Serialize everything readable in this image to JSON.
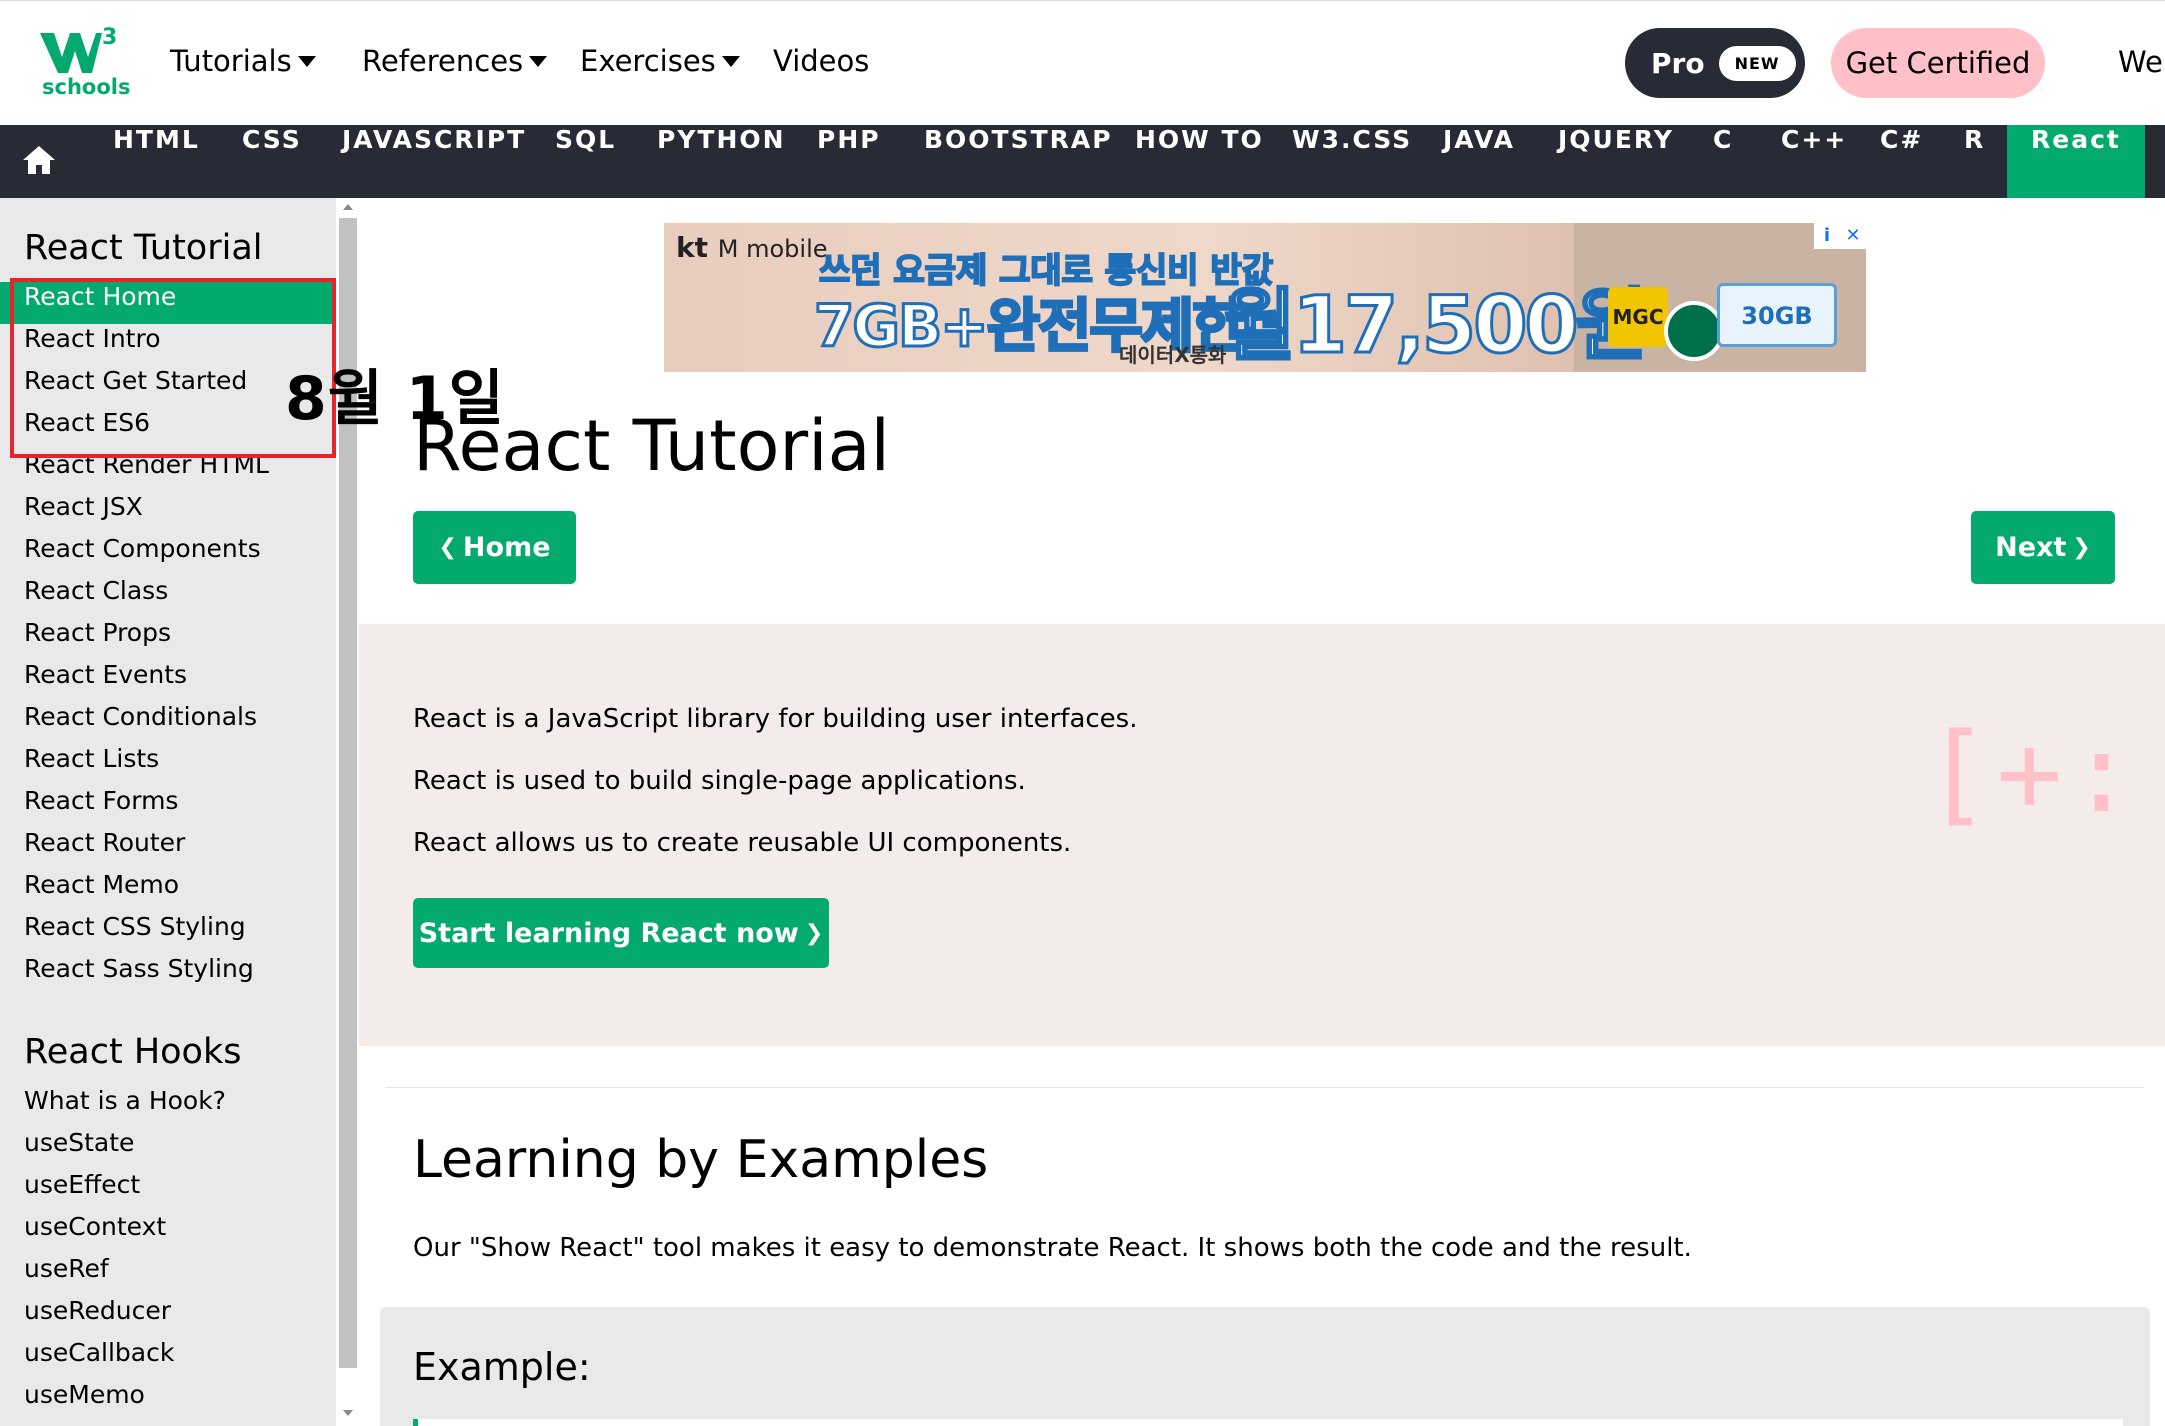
{
  "header": {
    "logo": {
      "superscript": "3",
      "wordmark": "schools"
    },
    "nav": [
      {
        "label": "Tutorials",
        "dropdown": true
      },
      {
        "label": "References",
        "dropdown": true
      },
      {
        "label": "Exercises",
        "dropdown": true
      },
      {
        "label": "Videos",
        "dropdown": false
      }
    ],
    "pro_label": "Pro",
    "pro_badge": "NEW",
    "certified_label": "Get Certified",
    "cut_label": "Web"
  },
  "subjects": {
    "home_icon": "home-icon",
    "items": [
      "HTML",
      "CSS",
      "JAVASCRIPT",
      "SQL",
      "PYTHON",
      "PHP",
      "BOOTSTRAP",
      "HOW TO",
      "W3.CSS",
      "JAVA",
      "JQUERY",
      "C",
      "C++",
      "C#",
      "R",
      "React"
    ],
    "active": "React"
  },
  "sidebar": {
    "section1_title": "React Tutorial",
    "section1_links": [
      "React Home",
      "React Intro",
      "React Get Started",
      "React ES6",
      "React Render HTML",
      "React JSX",
      "React Components",
      "React Class",
      "React Props",
      "React Events",
      "React Conditionals",
      "React Lists",
      "React Forms",
      "React Router",
      "React Memo",
      "React CSS Styling",
      "React Sass Styling"
    ],
    "active_link": "React Home",
    "section2_title": "React Hooks",
    "section2_links": [
      "What is a Hook?",
      "useState",
      "useEffect",
      "useContext",
      "useRef",
      "useReducer",
      "useCallback",
      "useMemo"
    ]
  },
  "annotation": {
    "text": "8월 1일",
    "box_color": "#E5252A"
  },
  "ad": {
    "brand": "kt",
    "brand_sub": "M mobile",
    "line1": "쓰던 요금제 그대로 통신비 반값",
    "line2": "7GB+완전무제한",
    "line3": "데이터X통화",
    "price": "월17,500원",
    "coupon": "30GB",
    "coupon_logo": "MGC",
    "info_icon": "i",
    "close_icon": "✕"
  },
  "main": {
    "title": "React Tutorial",
    "prev_label": "Home",
    "next_label": "Next",
    "intro_lines": [
      "React is a JavaScript library for building user interfaces.",
      "React is used to build single-page applications.",
      "React allows us to create reusable UI components."
    ],
    "decoration": "[+:",
    "start_label": "Start learning React now",
    "section_title": "Learning by Examples",
    "section_text": "Our \"Show React\" tool makes it easy to demonstrate React. It shows both the code and the result.",
    "example_title": "Example:"
  },
  "colors": {
    "accent": "#04AA6D",
    "dark": "#282A35",
    "pink": "#FFC0C7",
    "intro_bg": "#F3ECEA",
    "sidebar_bg": "#E7E9EB"
  }
}
